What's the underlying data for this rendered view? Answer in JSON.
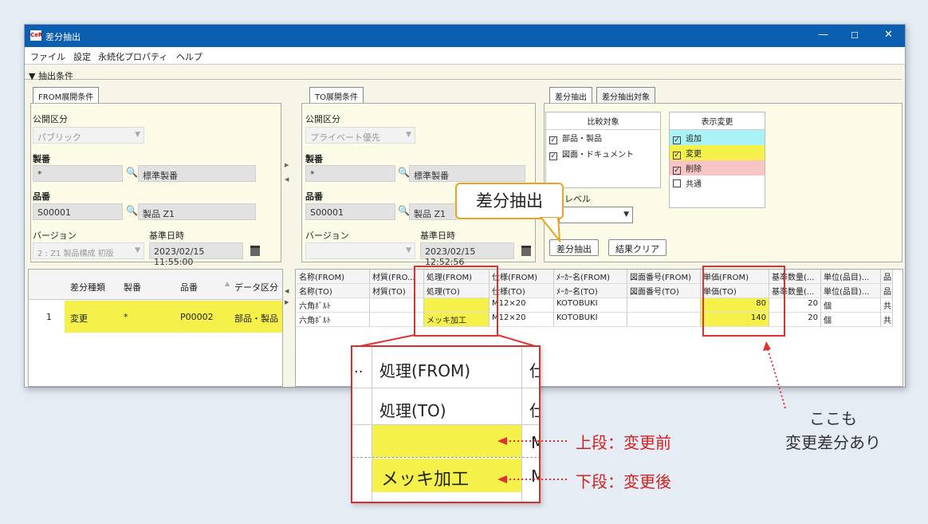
{
  "window": {
    "title": "差分抽出",
    "logo_text": "CeR",
    "min_icon": "—",
    "max_icon": "☐",
    "close_icon": "✕"
  },
  "menu": [
    "ファイル",
    "設定",
    "永続化プロパティ",
    "ヘルプ"
  ],
  "conditions_header": "▼ 抽出条件",
  "from": {
    "tab": "FROM展開条件",
    "visibility_label": "公開区分",
    "visibility_value": "パブリック",
    "seiban_label": "製番",
    "seiban_value": "*",
    "seiban_name": "標準製番",
    "hinban_label": "品番",
    "hinban_value": "S00001",
    "hinban_name": "製品 Z1",
    "version_label": "バージョン",
    "version_value": "2 : Z1 製品構成 初版",
    "date_label": "基準日時",
    "date_value": "2023/02/15 11:55:00"
  },
  "to": {
    "tab": "TO展開条件",
    "visibility_label": "公開区分",
    "visibility_value": "プライベート優先",
    "seiban_label": "製番",
    "seiban_value": "*",
    "seiban_name": "標準製番",
    "hinban_label": "品番",
    "hinban_value": "S00001",
    "hinban_name": "製品 Z1",
    "version_label": "バージョン",
    "version_value": "",
    "date_label": "基準日時",
    "date_value": "2023/02/15 12:52:56"
  },
  "diff": {
    "tabs": [
      "差分抽出",
      "差分抽出対象"
    ],
    "compare_header": "比較対象",
    "compare_items": [
      "部品・製品",
      "図面・ドキュメント"
    ],
    "display_header": "表示変更",
    "display_items": [
      {
        "label": "追加",
        "checked": true,
        "color": "#a9f3f7"
      },
      {
        "label": "変更",
        "checked": true,
        "color": "#f5f04a"
      },
      {
        "label": "削除",
        "checked": true,
        "color": "#f7c5c5"
      },
      {
        "label": "共通",
        "checked": false,
        "color": "#ffffff"
      }
    ],
    "level_label": "レベル",
    "extract_button": "差分抽出",
    "clear_button": "結果クリア"
  },
  "left_grid": {
    "headers": [
      "差分種類",
      "製番",
      "品番",
      "データ区分"
    ],
    "row": {
      "num": "1",
      "kind": "変更",
      "seiban": "*",
      "hinban": "P00002",
      "data": "部品・製品"
    }
  },
  "right_grid": {
    "headers_top": [
      "名称(FROM)",
      "材質(FRO...",
      "処理(FROM)",
      "仕様(FROM)",
      "ﾒｰｶｰ名(FROM)",
      "図面番号(FROM)",
      "単価(FROM)",
      "基準数量(...",
      "単位(品目)...",
      "品"
    ],
    "headers_bottom": [
      "名称(TO)",
      "材質(TO)",
      "処理(TO)",
      "仕様(TO)",
      "ﾒｰｶｰ名(TO)",
      "図面番号(TO)",
      "単価(TO)",
      "基準数量(...",
      "単位(品目)...",
      "品"
    ],
    "row_from": [
      "六角ﾎﾞﾙﾄ",
      "",
      "",
      "M12×20",
      "KOTOBUKI",
      "",
      "80",
      "20",
      "個",
      "共"
    ],
    "row_to": [
      "六角ﾎﾞﾙﾄ",
      "",
      "メッキ加工",
      "M12×20",
      "KOTOBUKI",
      "",
      "140",
      "20",
      "個",
      "共"
    ]
  },
  "callout": "差分抽出",
  "zoom": {
    "dots": "..",
    "head_from": "処理(FROM)",
    "head_to": "処理(TO)",
    "edge_char": "仕",
    "value": "メッキ加工",
    "edge_m": "M"
  },
  "annotations": {
    "upper": "上段：変更前",
    "lower": "下段：変更後",
    "note_line1": "ここも",
    "note_line2": "変更差分あり"
  }
}
